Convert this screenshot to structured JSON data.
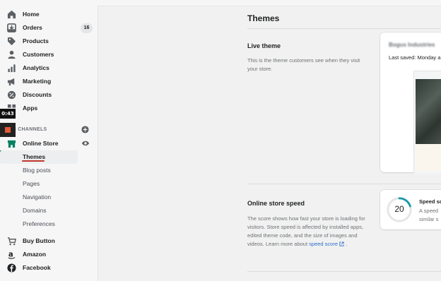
{
  "sidebar": {
    "items": [
      {
        "label": "Home",
        "icon": "home-icon"
      },
      {
        "label": "Orders",
        "icon": "orders-icon",
        "badge": "16"
      },
      {
        "label": "Products",
        "icon": "tag-icon"
      },
      {
        "label": "Customers",
        "icon": "person-icon"
      },
      {
        "label": "Analytics",
        "icon": "bar-chart-icon"
      },
      {
        "label": "Marketing",
        "icon": "megaphone-icon"
      },
      {
        "label": "Discounts",
        "icon": "discount-icon"
      },
      {
        "label": "Apps",
        "icon": "apps-icon"
      }
    ],
    "channels_title": "S CHANNELS",
    "online_store": "Online Store",
    "sub_items": [
      "Themes",
      "Blog posts",
      "Pages",
      "Navigation",
      "Domains",
      "Preferences"
    ],
    "other_channels": [
      "Buy Button",
      "Amazon",
      "Facebook"
    ]
  },
  "video_overlay": {
    "time": "0:43"
  },
  "main": {
    "page_title": "Themes",
    "live_theme": {
      "title": "Live theme",
      "description": "This is the theme customers see when they visit your store.",
      "theme_name": "Bogus Industries",
      "last_saved": "Last saved: Monday a"
    },
    "speed": {
      "title": "Online store speed",
      "description": "The score shows how fast your store is loading for visitors. Store speed is affected by installed apps, edited theme code, and the size of images and videos. Learn more about",
      "link": "speed score",
      "after_link": ".",
      "score": "20",
      "score_fraction": 0.2,
      "panel_head": "Speed sc",
      "panel_line1": "A speed",
      "panel_line2": "similar s"
    }
  },
  "colors": {
    "accent": "#008060",
    "link": "#2c6ecb",
    "score_ring": "#1b9aaa"
  }
}
